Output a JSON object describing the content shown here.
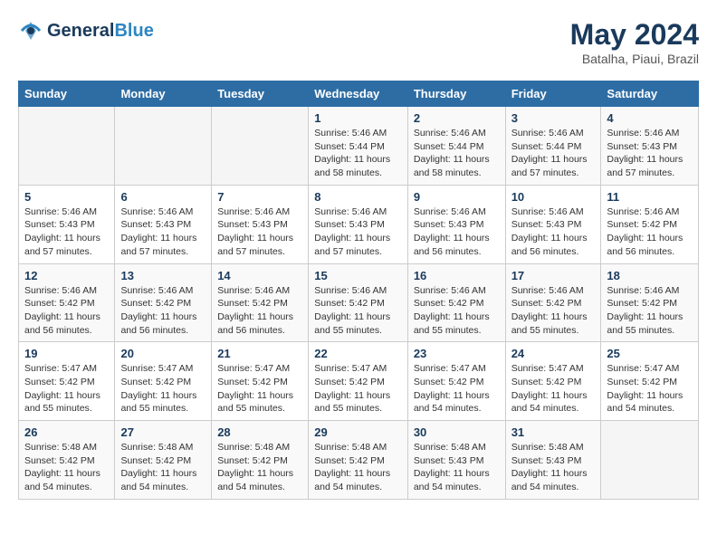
{
  "header": {
    "logo_line1": "General",
    "logo_line2": "Blue",
    "month": "May 2024",
    "location": "Batalha, Piaui, Brazil"
  },
  "weekdays": [
    "Sunday",
    "Monday",
    "Tuesday",
    "Wednesday",
    "Thursday",
    "Friday",
    "Saturday"
  ],
  "weeks": [
    [
      {
        "day": "",
        "info": ""
      },
      {
        "day": "",
        "info": ""
      },
      {
        "day": "",
        "info": ""
      },
      {
        "day": "1",
        "info": "Sunrise: 5:46 AM\nSunset: 5:44 PM\nDaylight: 11 hours\nand 58 minutes."
      },
      {
        "day": "2",
        "info": "Sunrise: 5:46 AM\nSunset: 5:44 PM\nDaylight: 11 hours\nand 58 minutes."
      },
      {
        "day": "3",
        "info": "Sunrise: 5:46 AM\nSunset: 5:44 PM\nDaylight: 11 hours\nand 57 minutes."
      },
      {
        "day": "4",
        "info": "Sunrise: 5:46 AM\nSunset: 5:43 PM\nDaylight: 11 hours\nand 57 minutes."
      }
    ],
    [
      {
        "day": "5",
        "info": "Sunrise: 5:46 AM\nSunset: 5:43 PM\nDaylight: 11 hours\nand 57 minutes."
      },
      {
        "day": "6",
        "info": "Sunrise: 5:46 AM\nSunset: 5:43 PM\nDaylight: 11 hours\nand 57 minutes."
      },
      {
        "day": "7",
        "info": "Sunrise: 5:46 AM\nSunset: 5:43 PM\nDaylight: 11 hours\nand 57 minutes."
      },
      {
        "day": "8",
        "info": "Sunrise: 5:46 AM\nSunset: 5:43 PM\nDaylight: 11 hours\nand 57 minutes."
      },
      {
        "day": "9",
        "info": "Sunrise: 5:46 AM\nSunset: 5:43 PM\nDaylight: 11 hours\nand 56 minutes."
      },
      {
        "day": "10",
        "info": "Sunrise: 5:46 AM\nSunset: 5:43 PM\nDaylight: 11 hours\nand 56 minutes."
      },
      {
        "day": "11",
        "info": "Sunrise: 5:46 AM\nSunset: 5:42 PM\nDaylight: 11 hours\nand 56 minutes."
      }
    ],
    [
      {
        "day": "12",
        "info": "Sunrise: 5:46 AM\nSunset: 5:42 PM\nDaylight: 11 hours\nand 56 minutes."
      },
      {
        "day": "13",
        "info": "Sunrise: 5:46 AM\nSunset: 5:42 PM\nDaylight: 11 hours\nand 56 minutes."
      },
      {
        "day": "14",
        "info": "Sunrise: 5:46 AM\nSunset: 5:42 PM\nDaylight: 11 hours\nand 56 minutes."
      },
      {
        "day": "15",
        "info": "Sunrise: 5:46 AM\nSunset: 5:42 PM\nDaylight: 11 hours\nand 55 minutes."
      },
      {
        "day": "16",
        "info": "Sunrise: 5:46 AM\nSunset: 5:42 PM\nDaylight: 11 hours\nand 55 minutes."
      },
      {
        "day": "17",
        "info": "Sunrise: 5:46 AM\nSunset: 5:42 PM\nDaylight: 11 hours\nand 55 minutes."
      },
      {
        "day": "18",
        "info": "Sunrise: 5:46 AM\nSunset: 5:42 PM\nDaylight: 11 hours\nand 55 minutes."
      }
    ],
    [
      {
        "day": "19",
        "info": "Sunrise: 5:47 AM\nSunset: 5:42 PM\nDaylight: 11 hours\nand 55 minutes."
      },
      {
        "day": "20",
        "info": "Sunrise: 5:47 AM\nSunset: 5:42 PM\nDaylight: 11 hours\nand 55 minutes."
      },
      {
        "day": "21",
        "info": "Sunrise: 5:47 AM\nSunset: 5:42 PM\nDaylight: 11 hours\nand 55 minutes."
      },
      {
        "day": "22",
        "info": "Sunrise: 5:47 AM\nSunset: 5:42 PM\nDaylight: 11 hours\nand 55 minutes."
      },
      {
        "day": "23",
        "info": "Sunrise: 5:47 AM\nSunset: 5:42 PM\nDaylight: 11 hours\nand 54 minutes."
      },
      {
        "day": "24",
        "info": "Sunrise: 5:47 AM\nSunset: 5:42 PM\nDaylight: 11 hours\nand 54 minutes."
      },
      {
        "day": "25",
        "info": "Sunrise: 5:47 AM\nSunset: 5:42 PM\nDaylight: 11 hours\nand 54 minutes."
      }
    ],
    [
      {
        "day": "26",
        "info": "Sunrise: 5:48 AM\nSunset: 5:42 PM\nDaylight: 11 hours\nand 54 minutes."
      },
      {
        "day": "27",
        "info": "Sunrise: 5:48 AM\nSunset: 5:42 PM\nDaylight: 11 hours\nand 54 minutes."
      },
      {
        "day": "28",
        "info": "Sunrise: 5:48 AM\nSunset: 5:42 PM\nDaylight: 11 hours\nand 54 minutes."
      },
      {
        "day": "29",
        "info": "Sunrise: 5:48 AM\nSunset: 5:42 PM\nDaylight: 11 hours\nand 54 minutes."
      },
      {
        "day": "30",
        "info": "Sunrise: 5:48 AM\nSunset: 5:43 PM\nDaylight: 11 hours\nand 54 minutes."
      },
      {
        "day": "31",
        "info": "Sunrise: 5:48 AM\nSunset: 5:43 PM\nDaylight: 11 hours\nand 54 minutes."
      },
      {
        "day": "",
        "info": ""
      }
    ]
  ]
}
